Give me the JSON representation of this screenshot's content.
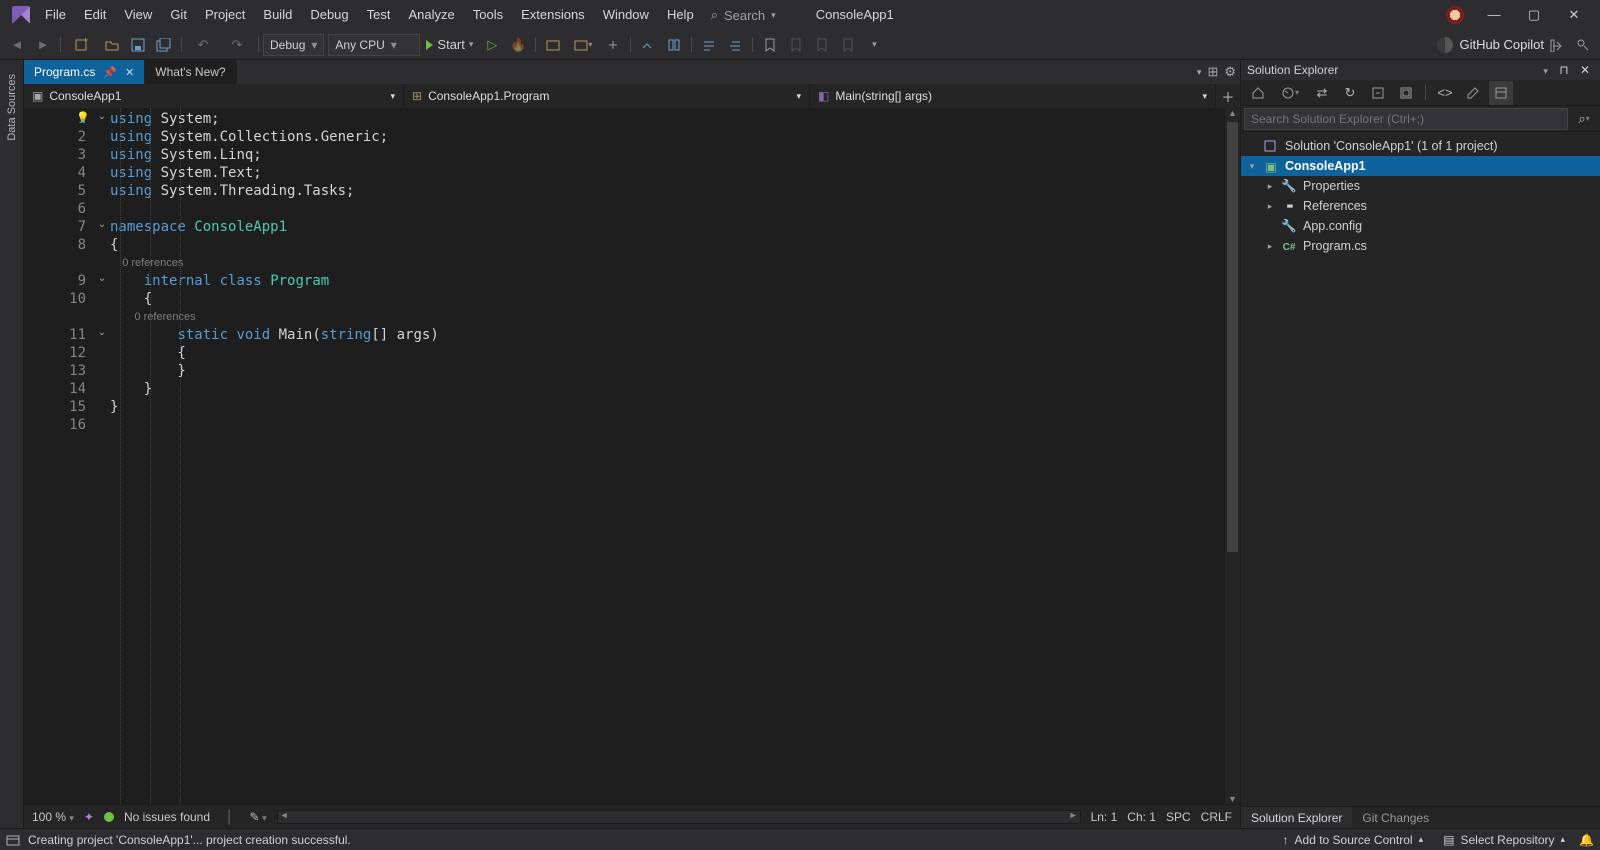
{
  "menu": [
    "File",
    "Edit",
    "View",
    "Git",
    "Project",
    "Build",
    "Debug",
    "Test",
    "Analyze",
    "Tools",
    "Extensions",
    "Window",
    "Help"
  ],
  "search_label": "Search",
  "app_name": "ConsoleApp1",
  "toolbar": {
    "config": "Debug",
    "platform": "Any CPU",
    "start_label": "Start",
    "copilot_label": "GitHub Copilot"
  },
  "vtabs": [
    "Data Sources"
  ],
  "tabs": [
    {
      "label": "Program.cs",
      "active": true,
      "pinned": true
    },
    {
      "label": "What's New?",
      "active": false,
      "pinned": false
    }
  ],
  "nav": {
    "project": "ConsoleApp1",
    "type": "ConsoleApp1.Program",
    "member": "Main(string[] args)"
  },
  "code": {
    "line_count": 16,
    "fold_at": [
      1,
      7,
      9,
      11
    ],
    "bulb_at": 1,
    "codelens": {
      "9": "0 references",
      "11": "0 references"
    },
    "lines": {
      "1": [
        [
          "kw",
          "using"
        ],
        [
          "pun",
          " System;"
        ]
      ],
      "2": [
        [
          "kw",
          "using"
        ],
        [
          "pun",
          " System.Collections.Generic;"
        ]
      ],
      "3": [
        [
          "kw",
          "using"
        ],
        [
          "pun",
          " System.Linq;"
        ]
      ],
      "4": [
        [
          "kw",
          "using"
        ],
        [
          "pun",
          " System.Text;"
        ]
      ],
      "5": [
        [
          "kw",
          "using"
        ],
        [
          "pun",
          " System.Threading.Tasks;"
        ]
      ],
      "6": [],
      "7": [
        [
          "kw",
          "namespace"
        ],
        [
          "pun",
          " "
        ],
        [
          "cls",
          "ConsoleApp1"
        ]
      ],
      "8": [
        [
          "pun",
          "{"
        ]
      ],
      "9": [
        [
          "pun",
          "    "
        ],
        [
          "kw",
          "internal"
        ],
        [
          "pun",
          " "
        ],
        [
          "kw",
          "class"
        ],
        [
          "pun",
          " "
        ],
        [
          "cls",
          "Program"
        ]
      ],
      "10": [
        [
          "pun",
          "    {"
        ]
      ],
      "11": [
        [
          "pun",
          "        "
        ],
        [
          "kw",
          "static"
        ],
        [
          "pun",
          " "
        ],
        [
          "kw",
          "void"
        ],
        [
          "pun",
          " Main("
        ],
        [
          "kw",
          "string"
        ],
        [
          "pun",
          "[] args)"
        ]
      ],
      "12": [
        [
          "pun",
          "        {"
        ]
      ],
      "13": [
        [
          "pun",
          "        }"
        ]
      ],
      "14": [
        [
          "pun",
          "    }"
        ]
      ],
      "15": [
        [
          "pun",
          "}"
        ]
      ],
      "16": []
    }
  },
  "editor_status": {
    "zoom": "100 %",
    "issues": "No issues found",
    "pos_ln": "Ln: 1",
    "pos_ch": "Ch: 1",
    "spc": "SPC",
    "eol": "CRLF"
  },
  "panel": {
    "title": "Solution Explorer",
    "search_placeholder": "Search Solution Explorer (Ctrl+;)",
    "tree": [
      {
        "depth": 0,
        "expander": "",
        "icon": "sln",
        "label": "Solution 'ConsoleApp1' (1 of 1 project)",
        "sel": false,
        "bold": false
      },
      {
        "depth": 0,
        "expander": "▾",
        "icon": "csproj",
        "label": "ConsoleApp1",
        "sel": true,
        "bold": true
      },
      {
        "depth": 1,
        "expander": "▸",
        "icon": "wrench",
        "label": "Properties",
        "sel": false,
        "bold": false
      },
      {
        "depth": 1,
        "expander": "▸",
        "icon": "refs",
        "label": "References",
        "sel": false,
        "bold": false
      },
      {
        "depth": 1,
        "expander": "",
        "icon": "cfg",
        "label": "App.config",
        "sel": false,
        "bold": false
      },
      {
        "depth": 1,
        "expander": "▸",
        "icon": "cs",
        "label": "Program.cs",
        "sel": false,
        "bold": false
      }
    ],
    "tabs": [
      "Solution Explorer",
      "Git Changes"
    ]
  },
  "statusbar": {
    "message": "Creating project 'ConsoleApp1'... project creation successful.",
    "source_control": "Add to Source Control",
    "repo": "Select Repository"
  }
}
